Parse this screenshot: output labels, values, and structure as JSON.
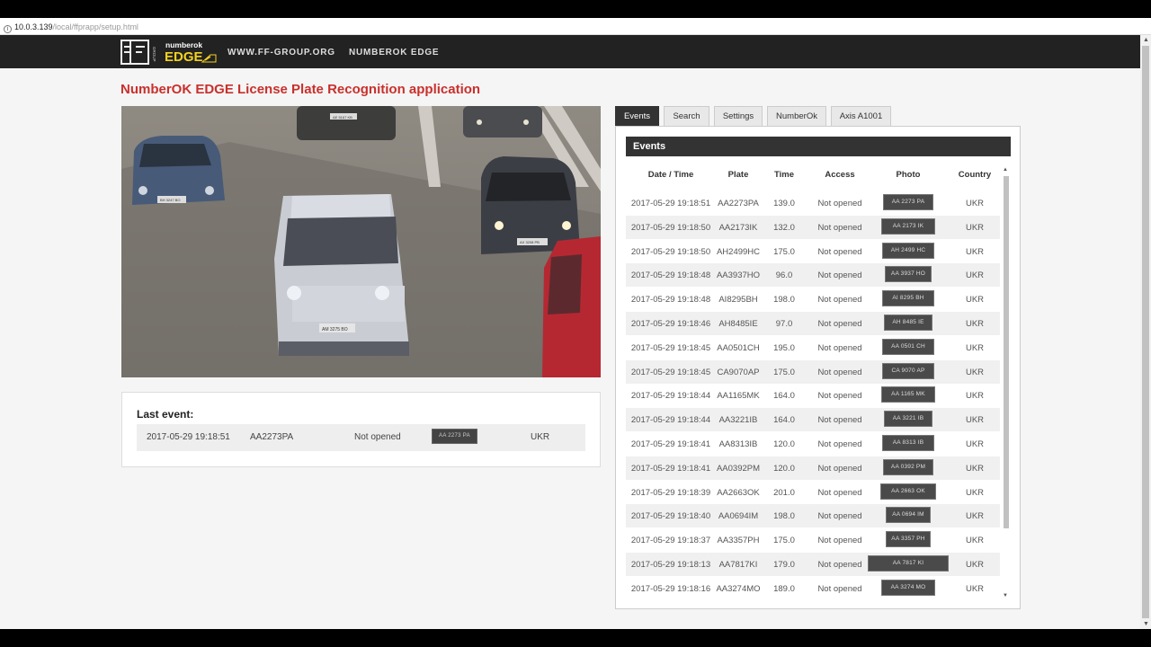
{
  "browser": {
    "url_host": "10.0.3.139",
    "url_path": "/local/ffprapp/setup.html"
  },
  "nav": {
    "logo_top": "numberok",
    "logo_bottom": "EDGE",
    "logo_brand": "GROUP",
    "link1": "WWW.FF-GROUP.ORG",
    "link2": "NUMBEROK EDGE"
  },
  "page_title": "NumberOK EDGE License Plate Recognition application",
  "camera": {
    "plate_left": "BH 3247 BO",
    "plate_center": "AM 3275 BO",
    "plate_right": "AX 3208 PB",
    "plate_top": "AE 5167 KB"
  },
  "last_event": {
    "title": "Last event:",
    "datetime": "2017-05-29 19:18:51",
    "plate": "AA2273PA",
    "access": "Not opened",
    "photo_text": "AA 2273 PA",
    "country": "UKR"
  },
  "tabs": [
    "Events",
    "Search",
    "Settings",
    "NumberOk",
    "Axis A1001"
  ],
  "events": {
    "header": "Events",
    "columns": [
      "Date / Time",
      "Plate",
      "Time",
      "Access",
      "Photo",
      "Country"
    ],
    "rows": [
      {
        "dt": "2017-05-29 19:18:51",
        "plate": "AA2273PA",
        "time": "139.0",
        "access": "Not opened",
        "photo": "AA 2273 PA",
        "country": "UKR"
      },
      {
        "dt": "2017-05-29 19:18:50",
        "plate": "AA2173IK",
        "time": "132.0",
        "access": "Not opened",
        "photo": "AA 2173 IK",
        "country": "UKR"
      },
      {
        "dt": "2017-05-29 19:18:50",
        "plate": "AH2499HC",
        "time": "175.0",
        "access": "Not opened",
        "photo": "AH 2499 HC",
        "country": "UKR"
      },
      {
        "dt": "2017-05-29 19:18:48",
        "plate": "AA3937HO",
        "time": "96.0",
        "access": "Not opened",
        "photo": "AA 3937 HO",
        "country": "UKR"
      },
      {
        "dt": "2017-05-29 19:18:48",
        "plate": "AI8295BH",
        "time": "198.0",
        "access": "Not opened",
        "photo": "AI 8295 BH",
        "country": "UKR"
      },
      {
        "dt": "2017-05-29 19:18:46",
        "plate": "AH8485IE",
        "time": "97.0",
        "access": "Not opened",
        "photo": "AH 8485 IE",
        "country": "UKR"
      },
      {
        "dt": "2017-05-29 19:18:45",
        "plate": "AA0501CH",
        "time": "195.0",
        "access": "Not opened",
        "photo": "AA 0501 CH",
        "country": "UKR"
      },
      {
        "dt": "2017-05-29 19:18:45",
        "plate": "CA9070AP",
        "time": "175.0",
        "access": "Not opened",
        "photo": "CA 9070 AP",
        "country": "UKR"
      },
      {
        "dt": "2017-05-29 19:18:44",
        "plate": "AA1165MK",
        "time": "164.0",
        "access": "Not opened",
        "photo": "AA 1165 MK",
        "country": "UKR"
      },
      {
        "dt": "2017-05-29 19:18:44",
        "plate": "AA3221IB",
        "time": "164.0",
        "access": "Not opened",
        "photo": "AA 3221 IB",
        "country": "UKR"
      },
      {
        "dt": "2017-05-29 19:18:41",
        "plate": "AA8313IB",
        "time": "120.0",
        "access": "Not opened",
        "photo": "AA 8313 IB",
        "country": "UKR"
      },
      {
        "dt": "2017-05-29 19:18:41",
        "plate": "AA0392PM",
        "time": "120.0",
        "access": "Not opened",
        "photo": "AA 0392 PM",
        "country": "UKR"
      },
      {
        "dt": "2017-05-29 19:18:39",
        "plate": "AA2663OK",
        "time": "201.0",
        "access": "Not opened",
        "photo": "AA 2663 OK",
        "country": "UKR"
      },
      {
        "dt": "2017-05-29 19:18:40",
        "plate": "AA0694IM",
        "time": "198.0",
        "access": "Not opened",
        "photo": "AA 0694 IM",
        "country": "UKR"
      },
      {
        "dt": "2017-05-29 19:18:37",
        "plate": "AA3357PH",
        "time": "175.0",
        "access": "Not opened",
        "photo": "AA 3357 PH",
        "country": "UKR"
      },
      {
        "dt": "2017-05-29 19:18:13",
        "plate": "AA7817KI",
        "time": "179.0",
        "access": "Not opened",
        "photo": "AA 7817 KI",
        "country": "UKR"
      },
      {
        "dt": "2017-05-29 19:18:16",
        "plate": "AA3274MO",
        "time": "189.0",
        "access": "Not opened",
        "photo": "AA 3274 MO",
        "country": "UKR"
      }
    ]
  }
}
